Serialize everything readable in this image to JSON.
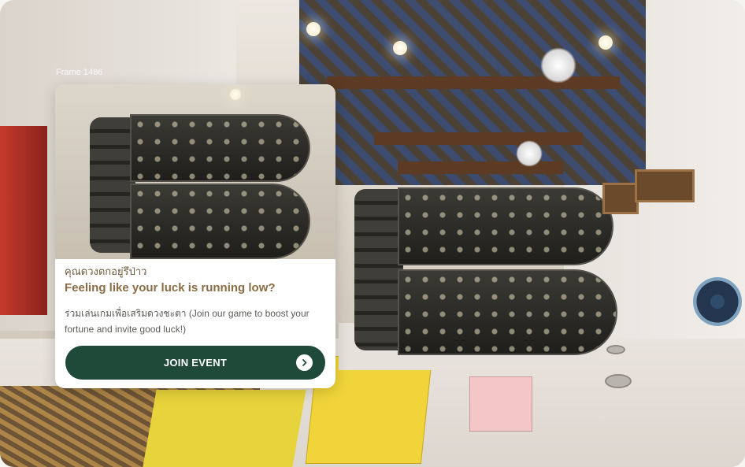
{
  "frame": {
    "label": "Frame 1486"
  },
  "popup": {
    "subtitle_thai": "คุณดวงตกอยู่รึป่าว",
    "headline": "Feeling like your luck is running low?",
    "description": "ร่วมเล่นเกมเพื่อเสริมดวงชะตา (Join our game to boost your fortune and invite good luck!)",
    "button_label": "JOIN EVENT",
    "button_icon": "chevron-right-icon"
  },
  "colors": {
    "button_bg": "#1f4a3a",
    "headline": "#8a6d45",
    "subtitle": "#6d5b3c"
  }
}
